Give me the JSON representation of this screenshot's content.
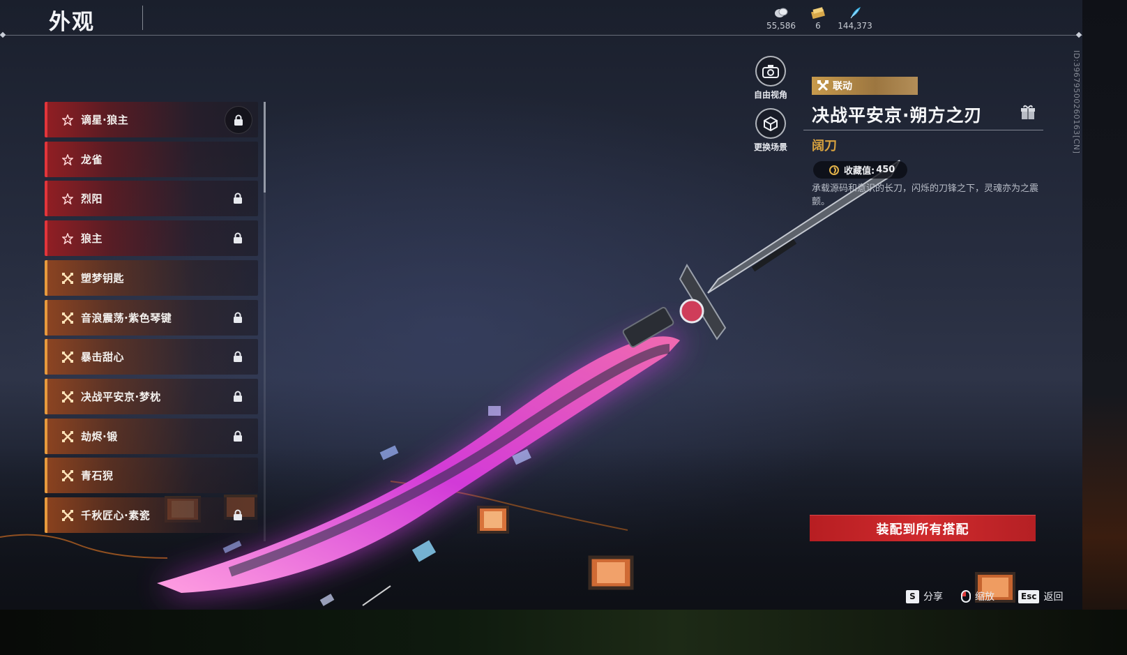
{
  "page": {
    "title": "外观"
  },
  "currencies": [
    {
      "icon": "coin-icon",
      "value": "55,586"
    },
    {
      "icon": "ticket-icon",
      "value": "6"
    },
    {
      "icon": "feather-icon",
      "value": "144,373"
    }
  ],
  "skin_list": {
    "items": [
      {
        "label": "谪星·狼主",
        "rarity": "red",
        "icon": "star-icon",
        "locked": true,
        "selected": true
      },
      {
        "label": "龙雀",
        "rarity": "red",
        "icon": "star-icon",
        "locked": false
      },
      {
        "label": "烈阳",
        "rarity": "red",
        "icon": "star-icon",
        "locked": true
      },
      {
        "label": "狼主",
        "rarity": "red",
        "icon": "star-icon",
        "locked": true
      },
      {
        "label": "塑梦钥匙",
        "rarity": "orange",
        "icon": "cross-swords-icon",
        "locked": false
      },
      {
        "label": "音浪震荡·紫色琴键",
        "rarity": "orange",
        "icon": "cross-swords-icon",
        "locked": true
      },
      {
        "label": "暴击甜心",
        "rarity": "orange",
        "icon": "cross-swords-icon",
        "locked": true
      },
      {
        "label": "决战平安京·梦枕",
        "rarity": "orange",
        "icon": "cross-swords-icon",
        "locked": true
      },
      {
        "label": "劫烬·锻",
        "rarity": "orange",
        "icon": "cross-swords-icon",
        "locked": true
      },
      {
        "label": "青石猊",
        "rarity": "orange",
        "icon": "cross-swords-icon",
        "locked": false
      },
      {
        "label": "千秋匠心·素瓷",
        "rarity": "orange",
        "icon": "cross-swords-icon",
        "locked": true
      }
    ]
  },
  "side_buttons": {
    "free_view": "自由视角",
    "change_scene": "更换场景"
  },
  "detail": {
    "tag": "联动",
    "name": "决战平安京·朔方之刃",
    "type": "阔刀",
    "collect_label": "收藏值:",
    "collect_value": "450",
    "description": "承载源码和意识的长刀，闪烁的刀锋之下，灵魂亦为之震颤。",
    "equip_button": "装配到所有搭配",
    "id_text": "ID:39679500260163[CN]"
  },
  "footer": {
    "share_key": "S",
    "share_label": "分享",
    "zoom_label": "缩放",
    "back_key": "Esc",
    "back_label": "返回"
  },
  "colors": {
    "red_accent": "#e2353b",
    "orange_accent": "#e79a3d",
    "gold_text": "#d9a33f",
    "button_red": "#cf2a2d",
    "blade_glow": "#e03cf0"
  }
}
